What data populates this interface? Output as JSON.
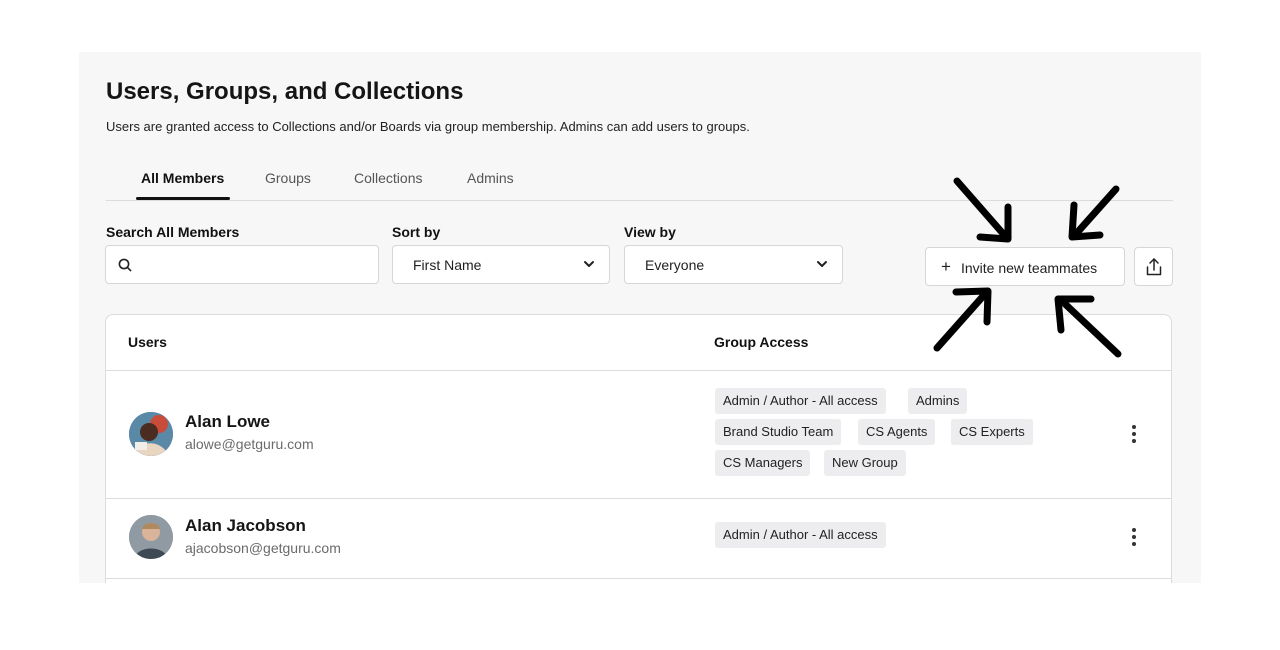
{
  "page": {
    "title": "Users, Groups, and Collections",
    "subtitle": "Users are granted access to Collections and/or Boards via group membership. Admins can add users to groups."
  },
  "tabs": [
    {
      "label": "All Members",
      "active": true
    },
    {
      "label": "Groups",
      "active": false
    },
    {
      "label": "Collections",
      "active": false
    },
    {
      "label": "Admins",
      "active": false
    }
  ],
  "search": {
    "label": "Search All Members",
    "value": "",
    "icon": "search-icon"
  },
  "sort": {
    "label": "Sort by",
    "value": "First Name"
  },
  "view": {
    "label": "View by",
    "value": "Everyone"
  },
  "actions": {
    "invite_label": "Invite new teammates",
    "invite_icon": "plus-icon",
    "export_icon": "share-icon"
  },
  "table": {
    "headers": {
      "users": "Users",
      "group_access": "Group Access"
    },
    "rows": [
      {
        "name": "Alan Lowe",
        "email": "alowe@getguru.com",
        "groups": [
          "Admin / Author - All access",
          "Admins",
          "Brand Studio Team",
          "CS Agents",
          "CS Experts",
          "CS Managers",
          "New Group"
        ]
      },
      {
        "name": "Alan Jacobson",
        "email": "ajacobson@getguru.com",
        "groups": [
          "Admin / Author - All access"
        ]
      }
    ]
  },
  "colors": {
    "panel_bg": "#f7f7f8",
    "tag_bg": "#ededef",
    "annotation_arrows": "#000000"
  }
}
